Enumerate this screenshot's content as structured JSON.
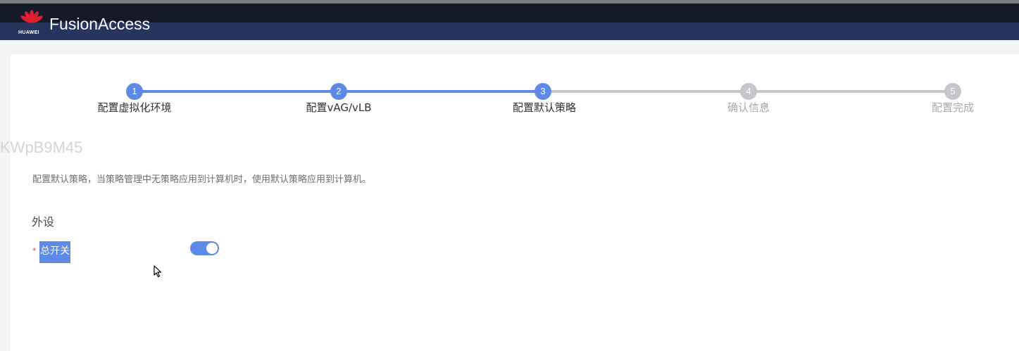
{
  "header": {
    "brand": "HUAWEI",
    "product": "FusionAccess",
    "logo_icon": "huawei-petal-logo"
  },
  "watermark": "KWpB9M45",
  "stepper": {
    "active_color": "#5d8ae6",
    "inactive_color": "#c3c5ca",
    "steps": [
      {
        "number": "1",
        "label": "配置虚拟化环境",
        "state": "done"
      },
      {
        "number": "2",
        "label": "配置vAG/vLB",
        "state": "done"
      },
      {
        "number": "3",
        "label": "配置默认策略",
        "state": "current"
      },
      {
        "number": "4",
        "label": "确认信息",
        "state": "pending"
      },
      {
        "number": "5",
        "label": "配置完成",
        "state": "pending"
      }
    ]
  },
  "content": {
    "description": "配置默认策略，当策略管理中无策略应用到计算机时，使用默认策略应用到计算机。",
    "section_title": "外设",
    "master_switch": {
      "required_mark": "*",
      "label": "总开关",
      "enabled": true
    }
  }
}
